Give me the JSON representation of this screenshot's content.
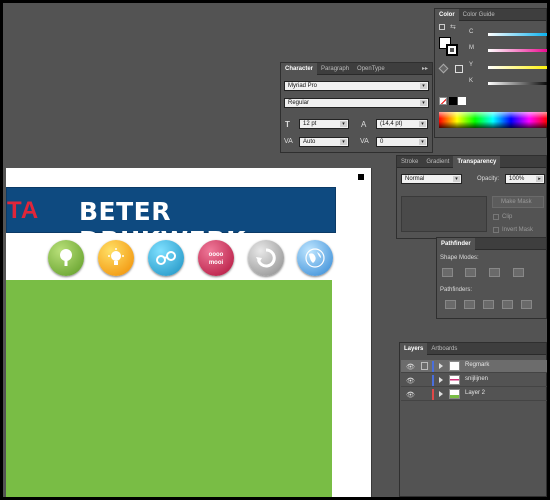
{
  "artboard": {
    "banner_fragment": "TA",
    "banner_title": "BETER DRUKWERK",
    "ball_icons": [
      "tree-icon",
      "lightbulb-icon",
      "chain-links-icon",
      "oooo-mooi-icon",
      "recycle-icon",
      "globe-icon"
    ],
    "ball_badge_text": "oooo\nmooi",
    "colors": {
      "banner": "#0e4a80",
      "green": "#79bd45",
      "red": "#e0263a"
    }
  },
  "color_panel": {
    "tabs": [
      "Color",
      "Color Guide"
    ],
    "channels": [
      "C",
      "M",
      "Y",
      "K"
    ]
  },
  "character_panel": {
    "tabs": [
      "Character",
      "Paragraph",
      "OpenType"
    ],
    "font_family": "Myriad Pro",
    "font_style": "Regular",
    "font_size": "12 pt",
    "leading": "(14,4 pt)",
    "kerning": "Auto",
    "tracking": "0"
  },
  "transparency_panel": {
    "tabs": [
      "Stroke",
      "Gradient",
      "Transparency"
    ],
    "blend_mode": "Normal",
    "opacity_label": "Opacity:",
    "opacity_value": "100%",
    "make_mask": "Make Mask",
    "clip": "Clip",
    "invert_mask": "Invert Mask"
  },
  "pathfinder_panel": {
    "tab": "Pathfinder",
    "shape_modes": "Shape Modes:",
    "pathfinders": "Pathfinders:"
  },
  "layers_panel": {
    "tabs": [
      "Layers",
      "Artboards"
    ],
    "rows": [
      {
        "name": "Regmark",
        "color": "#4a6fdc",
        "selected": true
      },
      {
        "name": "snijlijnen",
        "color": "#4a6fdc",
        "selected": false
      },
      {
        "name": "Layer 2",
        "color": "#e04848",
        "selected": false
      }
    ]
  }
}
